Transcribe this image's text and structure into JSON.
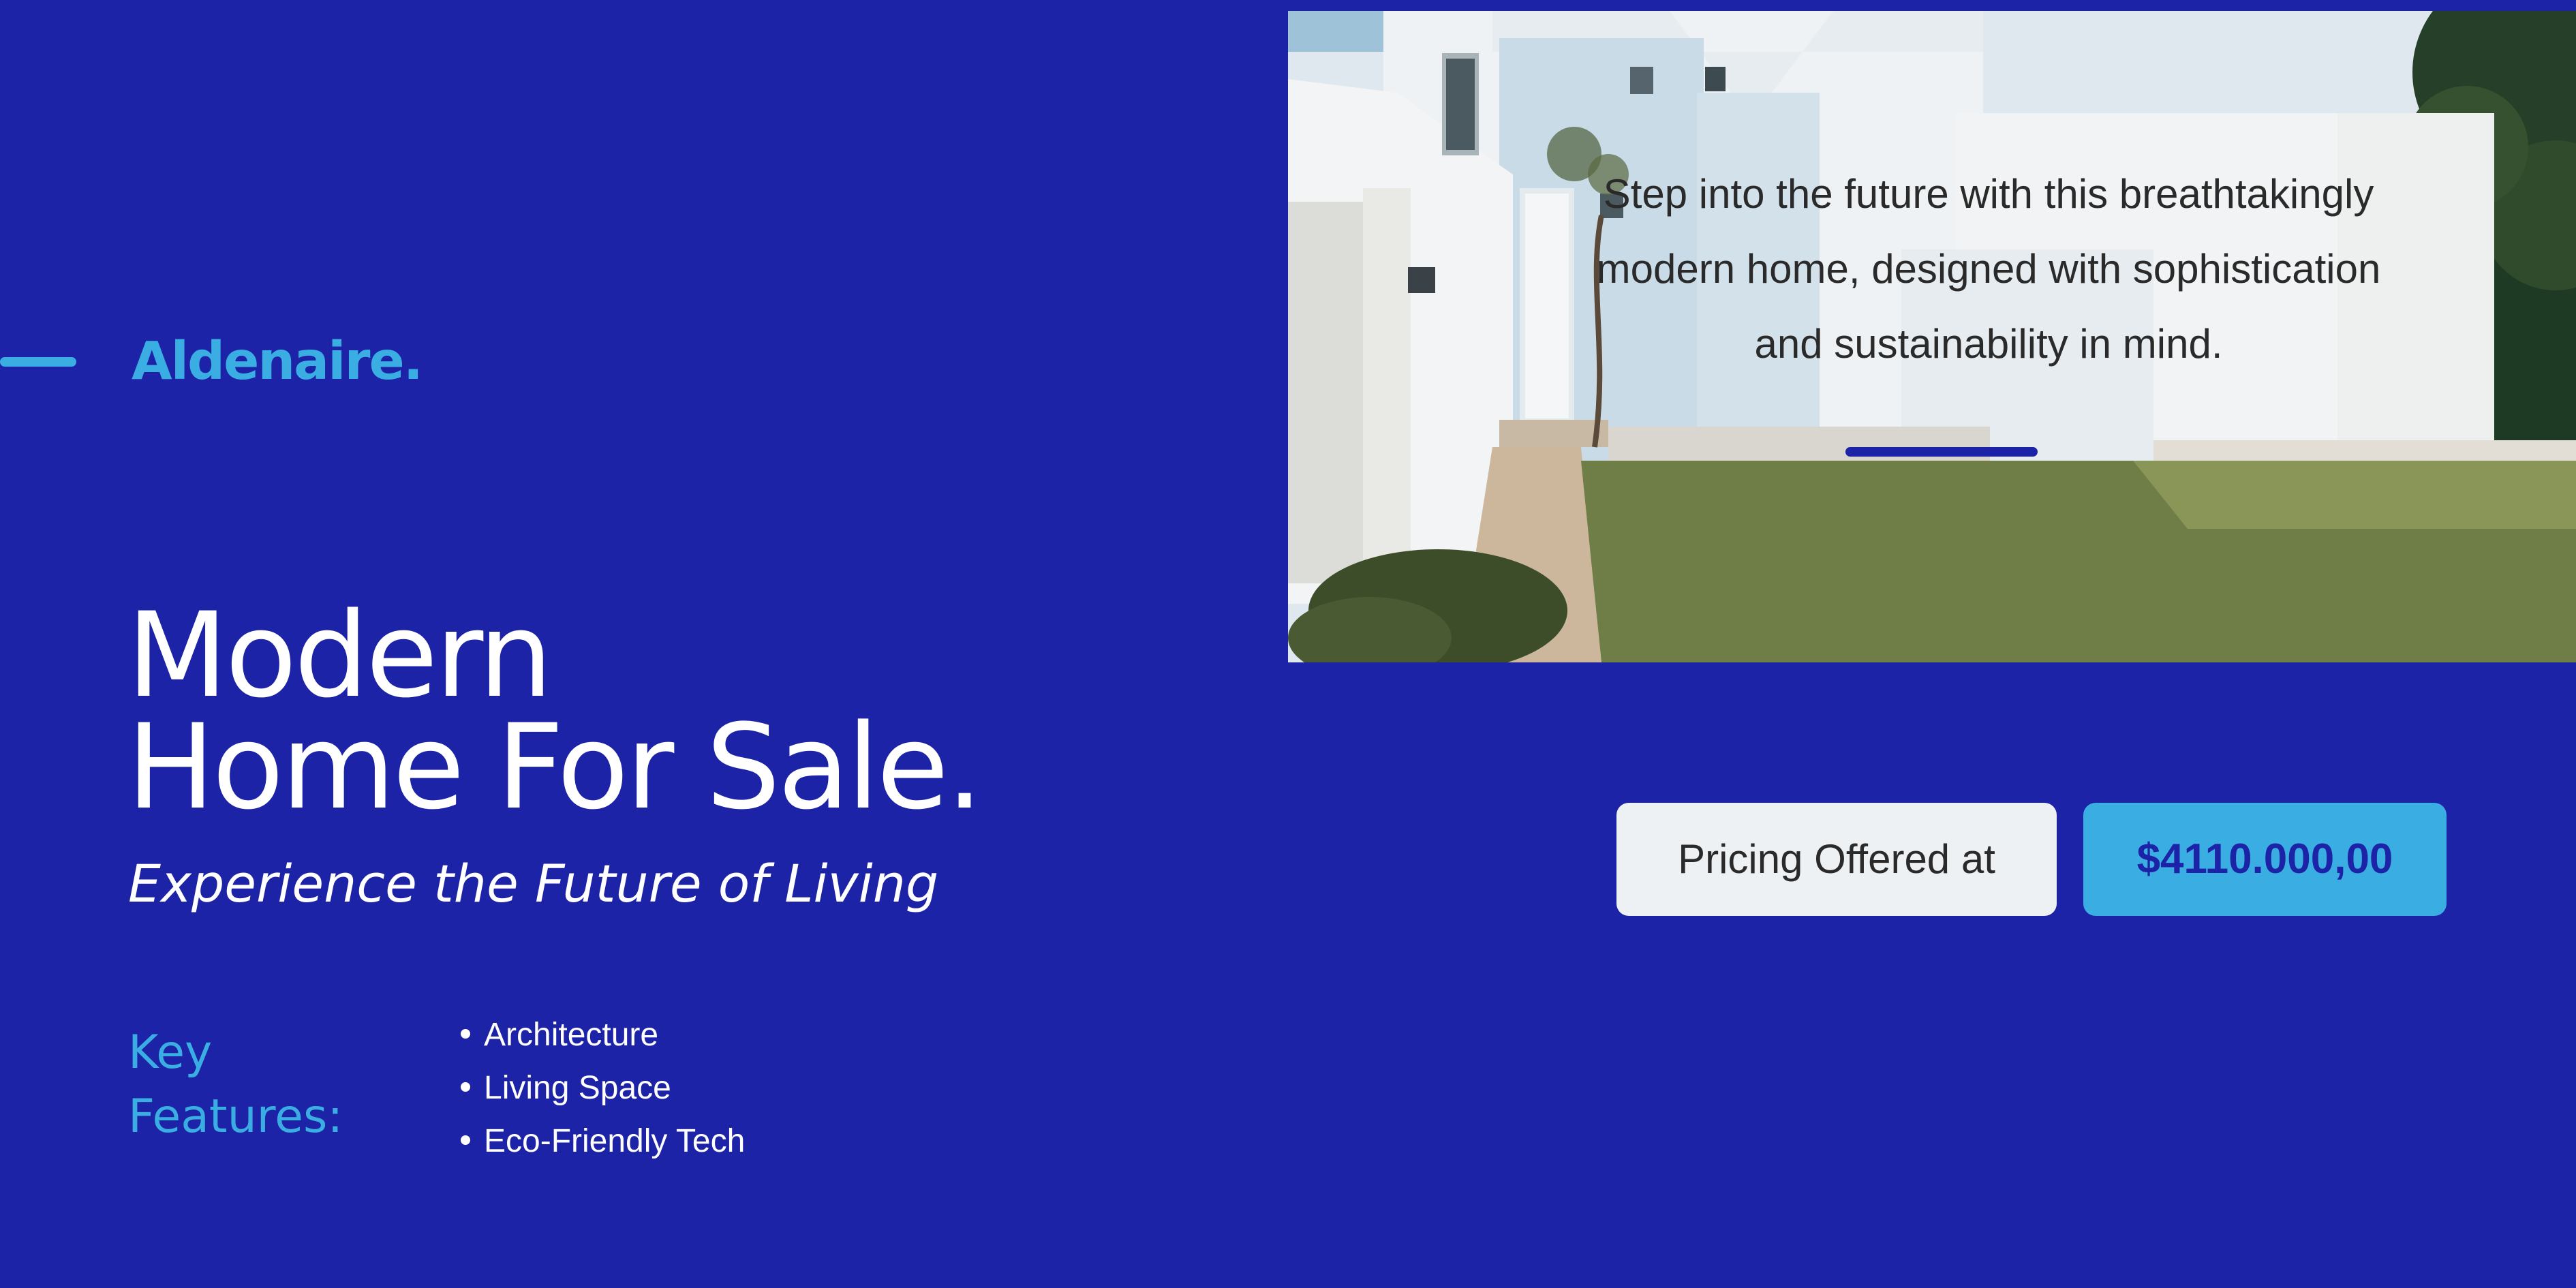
{
  "brand": {
    "name": "Aldenaire."
  },
  "hero": {
    "headline_line1": "Modern",
    "headline_line2": "Home For Sale.",
    "subheadline": "Experience the Future of Living"
  },
  "key_features": {
    "label_line1": "Key",
    "label_line2": "Features:",
    "items": [
      {
        "label": "Architecture"
      },
      {
        "label": "Living Space"
      },
      {
        "label": "Eco-Friendly Tech"
      }
    ]
  },
  "photo": {
    "caption_line1": "Step into the future with this breathtakingly",
    "caption_line2": "modern home, designed with sophistication",
    "caption_line3": "and sustainability in mind."
  },
  "pricing": {
    "label": "Pricing Offered at",
    "value": "$4110.000,00"
  },
  "colors": {
    "background": "#1c23a6",
    "accent": "#3aaee3",
    "light": "#eef1f4",
    "text_dark": "#2a2a2a"
  },
  "icons": {
    "bullet": "bullet-dot-icon",
    "brand_dash": "dash-line"
  }
}
